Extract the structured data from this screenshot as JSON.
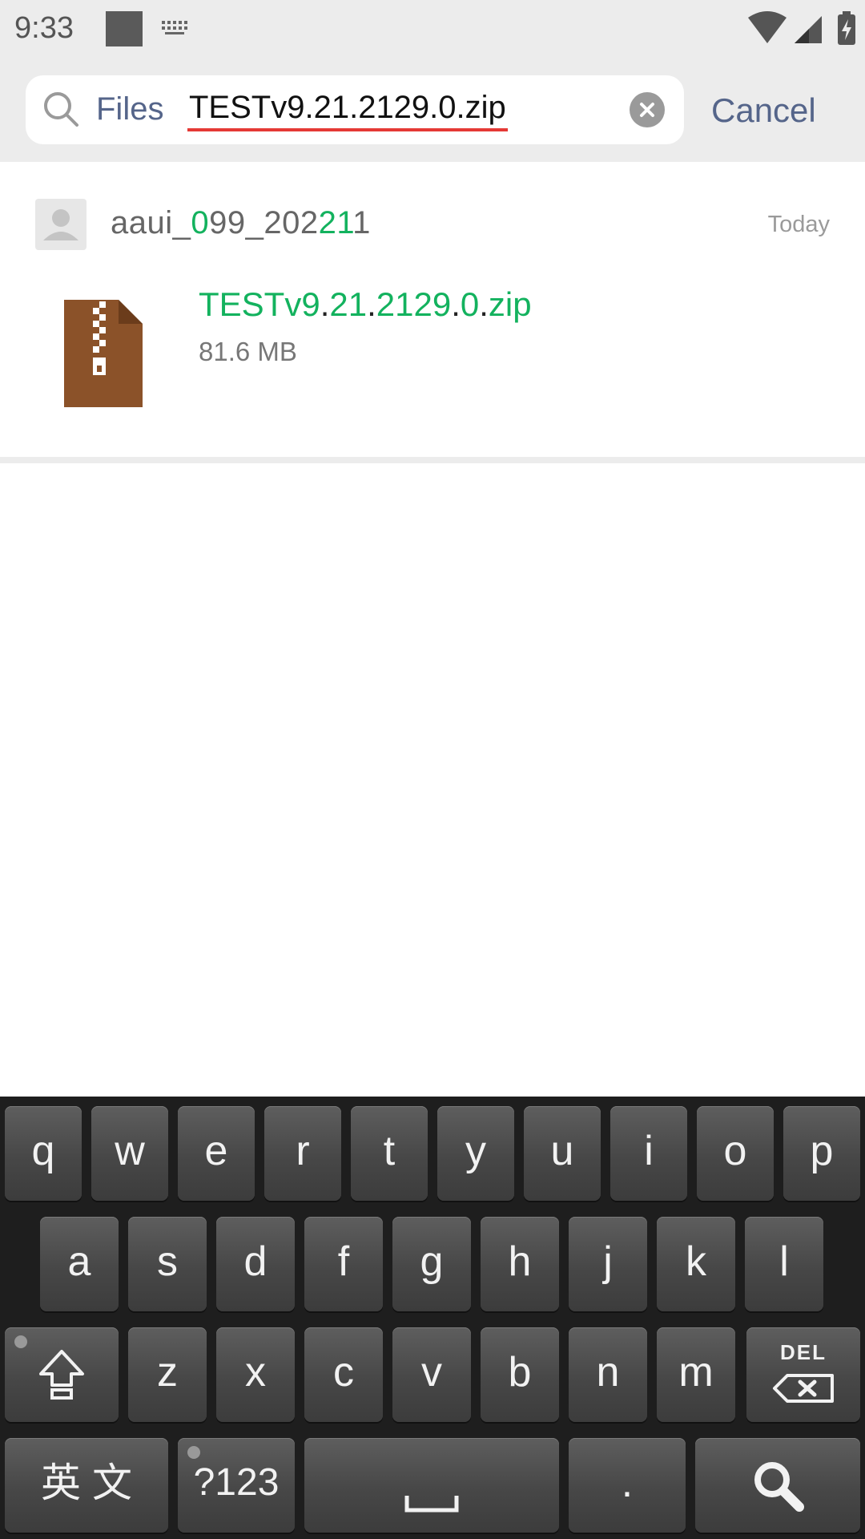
{
  "status_bar": {
    "time": "9:33"
  },
  "search": {
    "scope_label": "Files",
    "query": "TESTv9.21.2129.0.zip",
    "cancel_label": "Cancel"
  },
  "result": {
    "sender": {
      "p1": "aaui_",
      "p2": "0",
      "p3": "99_202",
      "p4": "21",
      "p5": "1"
    },
    "date": "Today",
    "file": {
      "name_parts": [
        "TESTv9",
        ".",
        "21",
        ".",
        "2129",
        ".",
        "0",
        ".",
        "zip"
      ],
      "size": "81.6 MB"
    }
  },
  "keyboard": {
    "row1": [
      "q",
      "w",
      "e",
      "r",
      "t",
      "y",
      "u",
      "i",
      "o",
      "p"
    ],
    "row2": [
      "a",
      "s",
      "d",
      "f",
      "g",
      "h",
      "j",
      "k",
      "l"
    ],
    "row3": [
      "z",
      "x",
      "c",
      "v",
      "b",
      "n",
      "m"
    ],
    "del_label": "DEL",
    "lang_label": "英 文",
    "num_label": "?123",
    "period_label": "."
  },
  "colors": {
    "highlight": "#13b25e",
    "accent": "#55658a",
    "file_icon": "#8b5229"
  },
  "icons": [
    "search-icon",
    "clear-icon",
    "avatar-icon",
    "zip-file-icon",
    "shift-icon",
    "delete-icon",
    "space-icon",
    "keyboard-search-icon",
    "wifi-icon",
    "signal-icon",
    "battery-icon"
  ]
}
